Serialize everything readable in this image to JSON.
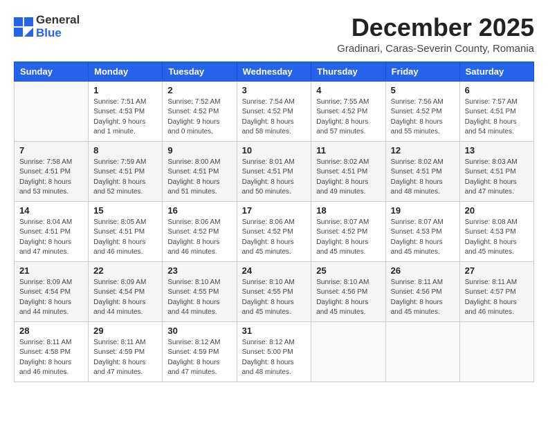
{
  "header": {
    "logo_general": "General",
    "logo_blue": "Blue",
    "title": "December 2025",
    "subtitle": "Gradinari, Caras-Severin County, Romania"
  },
  "calendar": {
    "columns": [
      "Sunday",
      "Monday",
      "Tuesday",
      "Wednesday",
      "Thursday",
      "Friday",
      "Saturday"
    ],
    "weeks": [
      [
        {
          "day": "",
          "info": ""
        },
        {
          "day": "1",
          "info": "Sunrise: 7:51 AM\nSunset: 4:53 PM\nDaylight: 9 hours\nand 1 minute."
        },
        {
          "day": "2",
          "info": "Sunrise: 7:52 AM\nSunset: 4:52 PM\nDaylight: 9 hours\nand 0 minutes."
        },
        {
          "day": "3",
          "info": "Sunrise: 7:54 AM\nSunset: 4:52 PM\nDaylight: 8 hours\nand 58 minutes."
        },
        {
          "day": "4",
          "info": "Sunrise: 7:55 AM\nSunset: 4:52 PM\nDaylight: 8 hours\nand 57 minutes."
        },
        {
          "day": "5",
          "info": "Sunrise: 7:56 AM\nSunset: 4:52 PM\nDaylight: 8 hours\nand 55 minutes."
        },
        {
          "day": "6",
          "info": "Sunrise: 7:57 AM\nSunset: 4:51 PM\nDaylight: 8 hours\nand 54 minutes."
        }
      ],
      [
        {
          "day": "7",
          "info": "Sunrise: 7:58 AM\nSunset: 4:51 PM\nDaylight: 8 hours\nand 53 minutes."
        },
        {
          "day": "8",
          "info": "Sunrise: 7:59 AM\nSunset: 4:51 PM\nDaylight: 8 hours\nand 52 minutes."
        },
        {
          "day": "9",
          "info": "Sunrise: 8:00 AM\nSunset: 4:51 PM\nDaylight: 8 hours\nand 51 minutes."
        },
        {
          "day": "10",
          "info": "Sunrise: 8:01 AM\nSunset: 4:51 PM\nDaylight: 8 hours\nand 50 minutes."
        },
        {
          "day": "11",
          "info": "Sunrise: 8:02 AM\nSunset: 4:51 PM\nDaylight: 8 hours\nand 49 minutes."
        },
        {
          "day": "12",
          "info": "Sunrise: 8:02 AM\nSunset: 4:51 PM\nDaylight: 8 hours\nand 48 minutes."
        },
        {
          "day": "13",
          "info": "Sunrise: 8:03 AM\nSunset: 4:51 PM\nDaylight: 8 hours\nand 47 minutes."
        }
      ],
      [
        {
          "day": "14",
          "info": "Sunrise: 8:04 AM\nSunset: 4:51 PM\nDaylight: 8 hours\nand 47 minutes."
        },
        {
          "day": "15",
          "info": "Sunrise: 8:05 AM\nSunset: 4:51 PM\nDaylight: 8 hours\nand 46 minutes."
        },
        {
          "day": "16",
          "info": "Sunrise: 8:06 AM\nSunset: 4:52 PM\nDaylight: 8 hours\nand 46 minutes."
        },
        {
          "day": "17",
          "info": "Sunrise: 8:06 AM\nSunset: 4:52 PM\nDaylight: 8 hours\nand 45 minutes."
        },
        {
          "day": "18",
          "info": "Sunrise: 8:07 AM\nSunset: 4:52 PM\nDaylight: 8 hours\nand 45 minutes."
        },
        {
          "day": "19",
          "info": "Sunrise: 8:07 AM\nSunset: 4:53 PM\nDaylight: 8 hours\nand 45 minutes."
        },
        {
          "day": "20",
          "info": "Sunrise: 8:08 AM\nSunset: 4:53 PM\nDaylight: 8 hours\nand 45 minutes."
        }
      ],
      [
        {
          "day": "21",
          "info": "Sunrise: 8:09 AM\nSunset: 4:54 PM\nDaylight: 8 hours\nand 44 minutes."
        },
        {
          "day": "22",
          "info": "Sunrise: 8:09 AM\nSunset: 4:54 PM\nDaylight: 8 hours\nand 44 minutes."
        },
        {
          "day": "23",
          "info": "Sunrise: 8:10 AM\nSunset: 4:55 PM\nDaylight: 8 hours\nand 44 minutes."
        },
        {
          "day": "24",
          "info": "Sunrise: 8:10 AM\nSunset: 4:55 PM\nDaylight: 8 hours\nand 45 minutes."
        },
        {
          "day": "25",
          "info": "Sunrise: 8:10 AM\nSunset: 4:56 PM\nDaylight: 8 hours\nand 45 minutes."
        },
        {
          "day": "26",
          "info": "Sunrise: 8:11 AM\nSunset: 4:56 PM\nDaylight: 8 hours\nand 45 minutes."
        },
        {
          "day": "27",
          "info": "Sunrise: 8:11 AM\nSunset: 4:57 PM\nDaylight: 8 hours\nand 46 minutes."
        }
      ],
      [
        {
          "day": "28",
          "info": "Sunrise: 8:11 AM\nSunset: 4:58 PM\nDaylight: 8 hours\nand 46 minutes."
        },
        {
          "day": "29",
          "info": "Sunrise: 8:11 AM\nSunset: 4:59 PM\nDaylight: 8 hours\nand 47 minutes."
        },
        {
          "day": "30",
          "info": "Sunrise: 8:12 AM\nSunset: 4:59 PM\nDaylight: 8 hours\nand 47 minutes."
        },
        {
          "day": "31",
          "info": "Sunrise: 8:12 AM\nSunset: 5:00 PM\nDaylight: 8 hours\nand 48 minutes."
        },
        {
          "day": "",
          "info": ""
        },
        {
          "day": "",
          "info": ""
        },
        {
          "day": "",
          "info": ""
        }
      ]
    ]
  }
}
